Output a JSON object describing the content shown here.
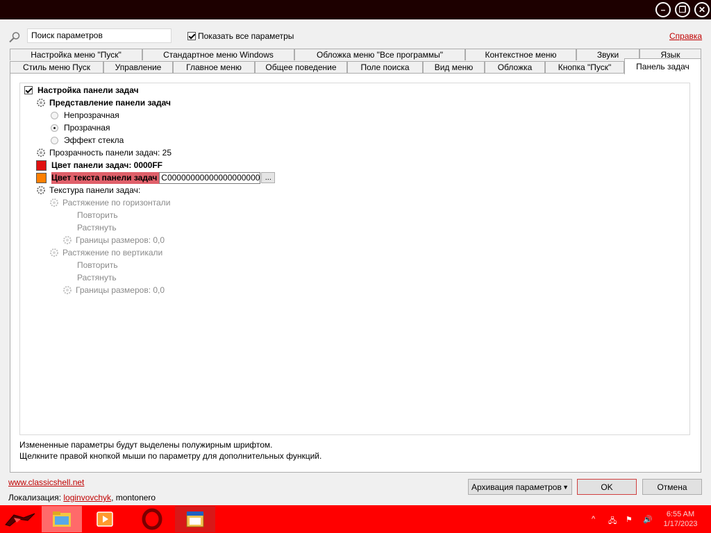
{
  "window": {
    "minimize_icon": "minimize-icon",
    "restore_icon": "restore-icon",
    "close_icon": "close-icon"
  },
  "search": {
    "value": "Поиск параметров"
  },
  "show_all": {
    "label": "Показать все параметры",
    "checked": true
  },
  "help": {
    "label": "Справка"
  },
  "tabs_row1": [
    "Настройка меню \"Пуск\"",
    "Стандартное меню Windows",
    "Обложка меню \"Все программы\"",
    "Контекстное меню",
    "Звуки",
    "Язык"
  ],
  "tabs_row2": [
    "Стиль меню Пуск",
    "Управление",
    "Главное меню",
    "Общее поведение",
    "Поле поиска",
    "Вид меню",
    "Обложка",
    "Кнопка \"Пуск\"",
    "Панель задач"
  ],
  "active_tab": "Панель задач",
  "tree": {
    "root": {
      "label": "Настройка панели задач",
      "checked": true
    },
    "view_group": "Представление панели задач",
    "opaque": "Непрозрачная",
    "transparent": "Прозрачная",
    "glass": "Эффект стекла",
    "opacity": "Прозрачность панели задач: 25",
    "color": "Цвет панели задач: 0000FF",
    "text_color_label": "Цвет текста панели задач",
    "text_color_value": "C000000000000000000000",
    "text_color_btn": "...",
    "texture": "Текстура панели задач:",
    "stretch_h": "Растяжение по горизонтали",
    "repeat_h": "Повторить",
    "stretch_h2": "Растянуть",
    "borders_h": "Границы размеров: 0,0",
    "stretch_v": "Растяжение по вертикали",
    "repeat_v": "Повторить",
    "stretch_v2": "Растянуть",
    "borders_v": "Границы размеров: 0,0"
  },
  "hints": {
    "line1": "Измененные параметры будут выделены полужирным шрифтом.",
    "line2": "Щелкните правой кнопкой мыши по параметру для дополнительных функций."
  },
  "footer": {
    "site": "www.classicshell.net",
    "loc_prefix": "Локализация: ",
    "loc_author": "loginvovchyk",
    "loc_suffix": ", montonero",
    "backup": "Архивация параметров",
    "ok": "OK",
    "cancel": "Отмена"
  },
  "taskbar": {
    "time": "6:55 AM",
    "date": "1/17/2023"
  },
  "colors": {
    "taskbar": "#ff0000",
    "swatch_taskbar": "#e01010",
    "swatch_text": "#ff8000",
    "accent": "#c00000",
    "selection": "#e0606a"
  }
}
